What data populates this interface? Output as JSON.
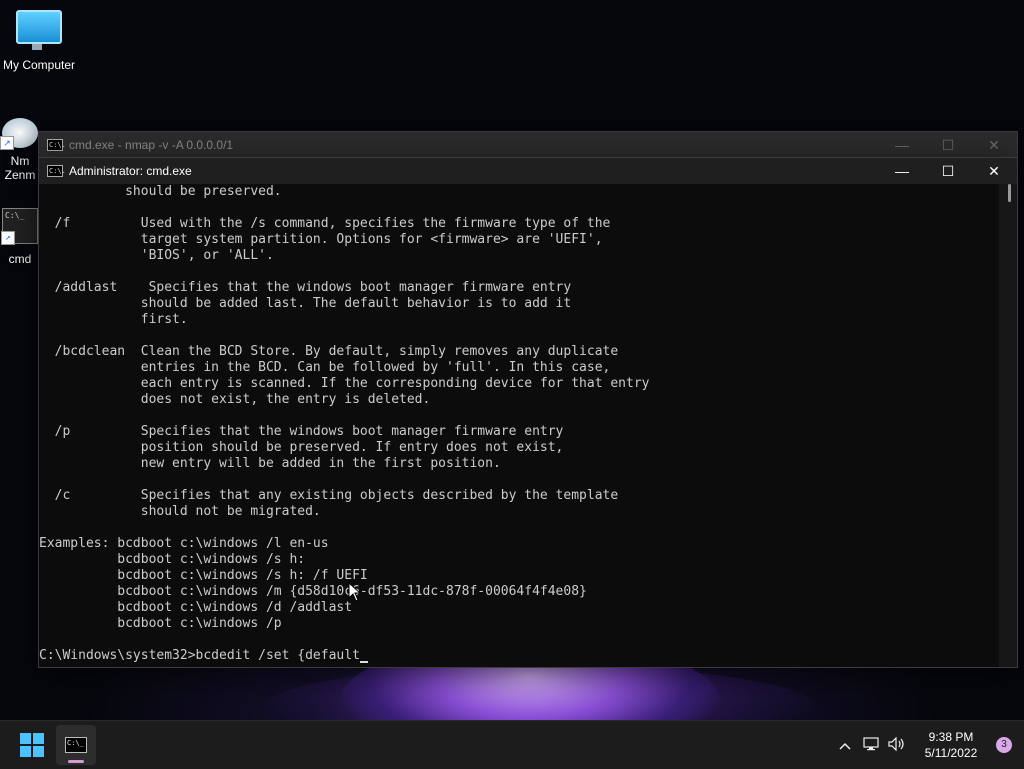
{
  "desktop": {
    "icons": [
      {
        "label": "My Computer"
      },
      {
        "label": "Nm\nZenm"
      },
      {
        "label": "cmd"
      }
    ]
  },
  "back_window": {
    "title": "cmd.exe - nmap  -v -A 0.0.0.0/1",
    "icon_text": "C:\\."
  },
  "front_window": {
    "title": "Administrator: cmd.exe",
    "icon_text": "C:\\."
  },
  "console_lines": [
    "           should be preserved.",
    "",
    "  /f         Used with the /s command, specifies the firmware type of the",
    "             target system partition. Options for <firmware> are 'UEFI',",
    "             'BIOS', or 'ALL'.",
    "",
    "  /addlast    Specifies that the windows boot manager firmware entry",
    "             should be added last. The default behavior is to add it",
    "             first.",
    "",
    "  /bcdclean  Clean the BCD Store. By default, simply removes any duplicate",
    "             entries in the BCD. Can be followed by 'full'. In this case,",
    "             each entry is scanned. If the corresponding device for that entry",
    "             does not exist, the entry is deleted.",
    "",
    "  /p         Specifies that the windows boot manager firmware entry",
    "             position should be preserved. If entry does not exist,",
    "             new entry will be added in the first position.",
    "",
    "  /c         Specifies that any existing objects described by the template",
    "             should not be migrated.",
    "",
    "Examples: bcdboot c:\\windows /l en-us",
    "          bcdboot c:\\windows /s h:",
    "          bcdboot c:\\windows /s h: /f UEFI",
    "          bcdboot c:\\windows /m {d58d10c6-df53-11dc-878f-00064f4f4e08}",
    "          bcdboot c:\\windows /d /addlast",
    "          bcdboot c:\\windows /p",
    ""
  ],
  "prompt": "C:\\Windows\\system32>bcdedit /set {default",
  "taskbar": {
    "time": "9:38 PM",
    "date": "5/11/2022",
    "notification_count": "3",
    "task_icon_text": "C:\\_"
  }
}
